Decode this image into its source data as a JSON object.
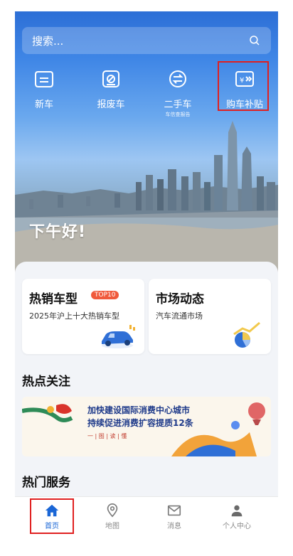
{
  "search": {
    "placeholder": "搜索..."
  },
  "quick_nav": [
    {
      "label": "新车",
      "icon": "car-front-icon"
    },
    {
      "label": "报废车",
      "icon": "scrap-car-icon"
    },
    {
      "label": "二手车",
      "sublabel": "车信查报告",
      "icon": "exchange-icon"
    },
    {
      "label": "购车补贴",
      "icon": "subsidy-yen-icon"
    }
  ],
  "greeting": "下午好!",
  "cards": [
    {
      "title": "热销车型",
      "badge": "TOP10",
      "subtitle": "2025年沪上十大热销车型"
    },
    {
      "title": "市场动态",
      "subtitle": "汽车流通市场"
    }
  ],
  "hot_topics": {
    "title": "热点关注",
    "banner_line1": "加快建设国际消费中心城市",
    "banner_line2": "持续促进消费扩容提质12条",
    "banner_line3": "一 | 图 | 读 | 懂"
  },
  "hot_services": {
    "title": "热门服务"
  },
  "tabs": [
    {
      "label": "首页",
      "icon": "home-icon",
      "active": true
    },
    {
      "label": "地图",
      "icon": "map-pin-icon"
    },
    {
      "label": "消息",
      "icon": "mail-icon"
    },
    {
      "label": "个人中心",
      "icon": "user-icon"
    }
  ],
  "colors": {
    "accent": "#1a66d6",
    "badge": "#f05a3c",
    "highlight": "#e02020"
  }
}
